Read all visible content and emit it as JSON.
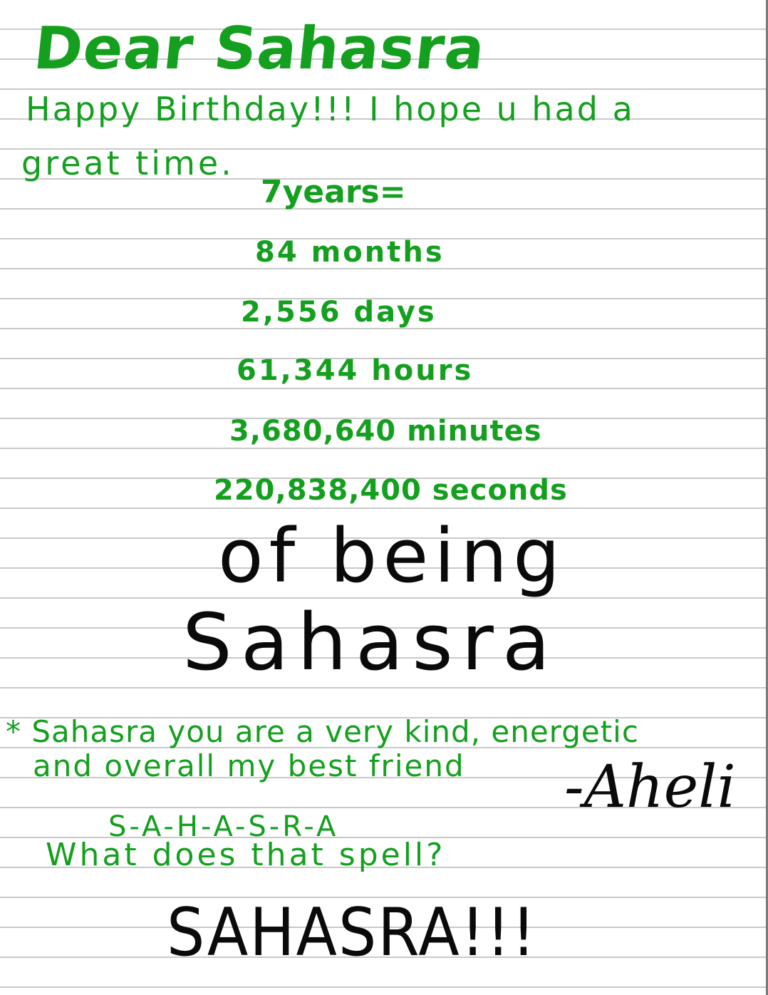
{
  "letter": {
    "salutation": "Dear Sahasra",
    "greeting_line_1": "Happy Birthday!!! I hope u had a",
    "greeting_line_2": "great time.",
    "stats": {
      "years": "7years=",
      "months": "84 months",
      "days": "2,556 days",
      "hours": "61,344 hours",
      "minutes": "3,680,640 minutes",
      "seconds": "220,838,400 seconds"
    },
    "headline_1": "of being",
    "headline_2": "Sahasra",
    "note_line_1": "* Sahasra you are a very kind, energetic",
    "note_line_2": "and overall my best friend",
    "signature": "-Aheli",
    "spell_letters": "S-A-H-A-S-R-A",
    "spell_question": "What does that spell?",
    "answer": "SAHASRA!!!"
  },
  "colors": {
    "ink_green": "#14a01e",
    "ink_black": "#0a0a0a",
    "ruled_line": "#c9c9c9",
    "paper": "#ffffff"
  }
}
